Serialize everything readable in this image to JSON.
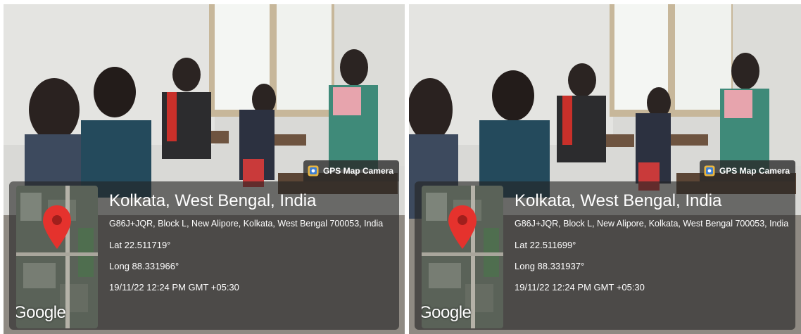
{
  "photos": [
    {
      "badge": "GPS Map Camera",
      "location_title": "Kolkata, West Bengal, India",
      "address": "G86J+JQR, Block L, New Alipore, Kolkata, West Bengal 700053, India",
      "lat": "Lat 22.511719°",
      "long": "Long 88.331966°",
      "timestamp": "19/11/22 12:24 PM GMT +05:30",
      "map_logo": "Google"
    },
    {
      "badge": "GPS Map Camera",
      "location_title": "Kolkata, West Bengal, India",
      "address": "G86J+JQR, Block L, New Alipore, Kolkata, West Bengal 700053, India",
      "lat": "Lat 22.511699°",
      "long": "Long 88.331937°",
      "timestamp": "19/11/22 12:24 PM GMT +05:30",
      "map_logo": "Google"
    }
  ],
  "icons": {
    "camera": "gps-camera-icon",
    "pin": "map-pin-icon"
  },
  "colors": {
    "pin": "#e5322d",
    "overlay": "#232323",
    "text": "#ffffff"
  }
}
